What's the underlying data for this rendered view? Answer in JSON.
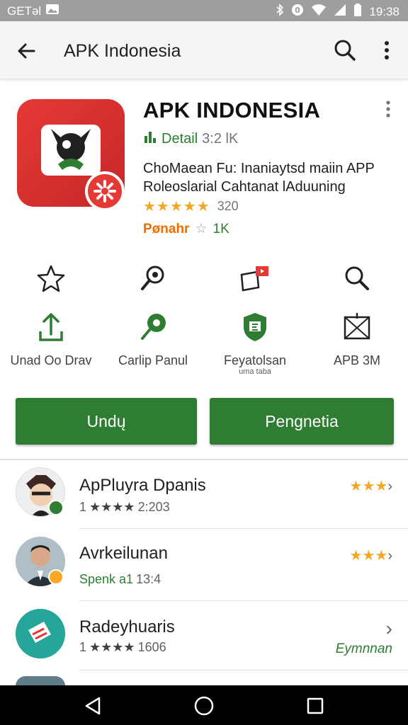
{
  "status_bar": {
    "left_text": "GETəl",
    "time": "19:38"
  },
  "toolbar": {
    "title": "APK Indonesia"
  },
  "app": {
    "name": "APK INDONESIA",
    "detail_label": "Detail",
    "detail_value": "3:2 lK",
    "description_line1": "ChoMaean Fu: Inaniaytsd maiin APP",
    "description_line2": "Roleoslarial Cahtanat lAduuning",
    "rating_stars": "★★★★★",
    "rating_count": "320",
    "developer": "Pønahr",
    "developer_star": "☆",
    "developer_count": "1K"
  },
  "actions_row1": [
    {
      "icon": "star-outline-icon"
    },
    {
      "icon": "search-pin-icon"
    },
    {
      "icon": "flag-card-icon"
    },
    {
      "icon": "search-icon"
    }
  ],
  "actions_row2": [
    {
      "icon": "upload-icon",
      "label": "Unad Oo Drav",
      "sub": ""
    },
    {
      "icon": "pin-icon",
      "label": "Carlip Panul",
      "sub": ""
    },
    {
      "icon": "shield-icon",
      "label": "Feyatolsan",
      "sub": "uma taba"
    },
    {
      "icon": "image-frame-icon",
      "label": "APB 3M",
      "sub": ""
    }
  ],
  "buttons": {
    "download": "Undų",
    "info": "Pengnetia"
  },
  "list": [
    {
      "title": "ApPluyra Dpanis",
      "sub_prefix": "1",
      "stars": "★★★★",
      "sub_value": "2:203",
      "right": "★★★",
      "right_chevron": "›"
    },
    {
      "title": "Avrkeilunan",
      "sub_prefix": "Spenk a1",
      "stars": "",
      "sub_value": "13:4",
      "right": "★★★",
      "right_chevron": "›"
    },
    {
      "title": "Radeyhuaris",
      "sub_prefix": "1",
      "stars": "★★★★",
      "sub_value": "1606",
      "right": "Eymnnan",
      "right_chevron": "›"
    }
  ],
  "colors": {
    "accent_green": "#2e7d32",
    "brand_red": "#e53935",
    "star_orange": "#f5a623"
  }
}
